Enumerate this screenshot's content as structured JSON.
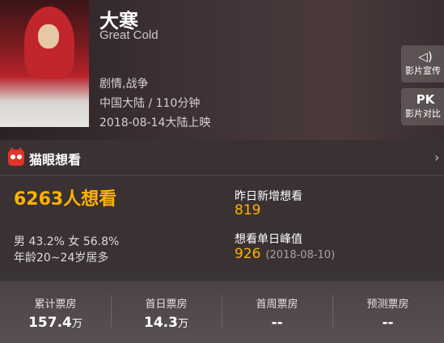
{
  "movie": {
    "title_cn": "大寒",
    "title_en": "Great Cold",
    "genres": "剧情,战争",
    "region_duration": "中国大陆 / 110分钟",
    "release": "2018-08-14大陆上映"
  },
  "poster": {
    "brush_title": "大寒",
    "en_text": "GREAT COLD"
  },
  "side_buttons": [
    {
      "icon": "speaker-icon",
      "icon_glyph": "◁)",
      "label": "影片宣传"
    },
    {
      "icon": "pk-icon",
      "icon_glyph": "PK",
      "label": "影片对比"
    }
  ],
  "wish": {
    "panel_title": "猫眼想看",
    "more_glyph": "›",
    "total": "6263人想看",
    "gender": "男 43.2% 女 56.8%",
    "age": "年龄20~24岁居多",
    "yesterday_label": "昨日新增想看",
    "yesterday_value": "819",
    "peak_label": "想看单日峰值",
    "peak_value": "926",
    "peak_date": "(2018-08-10)"
  },
  "boxoffice": [
    {
      "label": "累计票房",
      "value": "157.4",
      "unit": "万"
    },
    {
      "label": "首日票房",
      "value": "14.3",
      "unit": "万"
    },
    {
      "label": "首周票房",
      "value": "--",
      "unit": ""
    },
    {
      "label": "预测票房",
      "value": "--",
      "unit": ""
    }
  ],
  "colors": {
    "accent": "#ffb400",
    "brand_red": "#e5332a"
  }
}
